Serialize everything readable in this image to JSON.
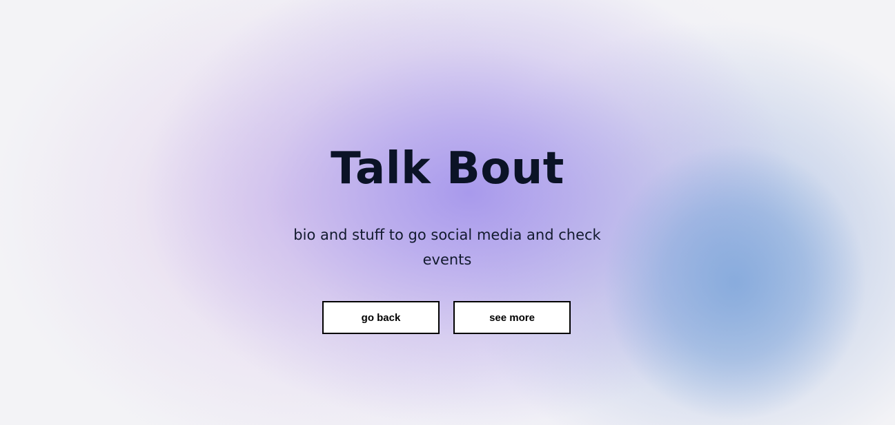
{
  "hero": {
    "title": "Talk Bout",
    "subtitle": "bio and stuff to go social media and check events",
    "buttons": {
      "back_label": "go back",
      "more_label": "see more"
    }
  },
  "colors": {
    "title": "#0b1326",
    "button_bg": "#ffffff",
    "button_border": "#000000",
    "gradient_purple": "#a596ec",
    "gradient_blue": "#86aadc",
    "page_bg": "#f3f3f6"
  }
}
